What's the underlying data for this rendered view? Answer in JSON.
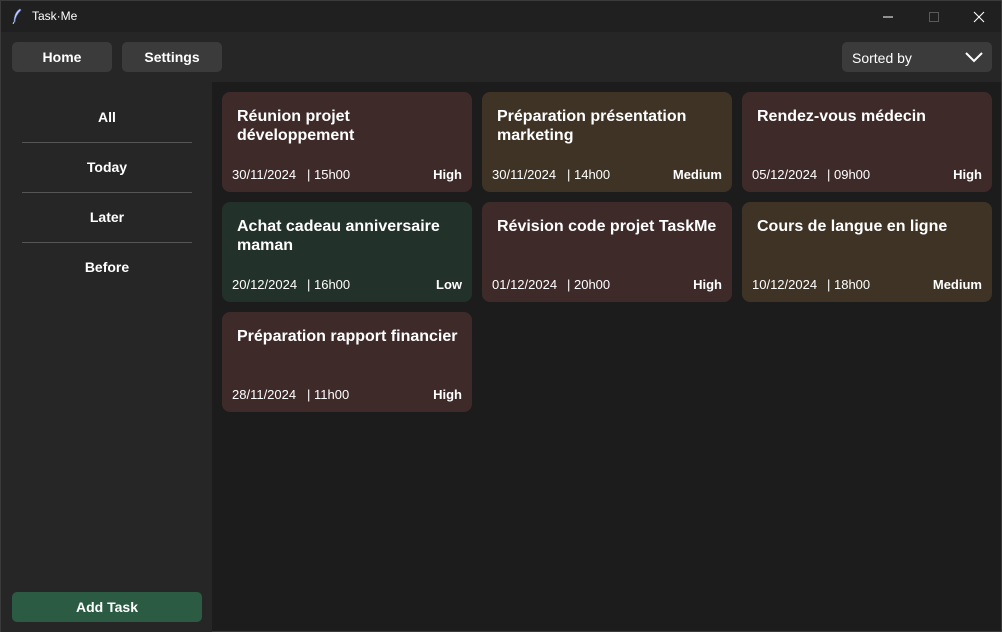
{
  "window": {
    "title": "Task·Me"
  },
  "topbar": {
    "home_label": "Home",
    "settings_label": "Settings",
    "sort_label": "Sorted by"
  },
  "sidebar": {
    "filters": [
      "All",
      "Today",
      "Later",
      "Before"
    ],
    "add_task_label": "Add Task"
  },
  "colors": {
    "high": "#3f2a2a",
    "medium": "#3e3325",
    "low": "#223129",
    "add_task": "#2b5c43"
  },
  "tasks": [
    {
      "title": "Réunion projet développement",
      "date": "30/11/2024",
      "time": "| 15h00",
      "priority": "High"
    },
    {
      "title": "Préparation présentation marketing",
      "date": "30/11/2024",
      "time": "| 14h00",
      "priority": "Medium"
    },
    {
      "title": "Rendez-vous médecin",
      "date": "05/12/2024",
      "time": "| 09h00",
      "priority": "High"
    },
    {
      "title": "Achat cadeau anniversaire maman",
      "date": "20/12/2024",
      "time": "| 16h00",
      "priority": "Low"
    },
    {
      "title": "Révision code projet TaskMe",
      "date": "01/12/2024",
      "time": "| 20h00",
      "priority": "High"
    },
    {
      "title": "Cours de langue en ligne",
      "date": "10/12/2024",
      "time": "| 18h00",
      "priority": "Medium"
    },
    {
      "title": "Préparation rapport financier",
      "date": "28/11/2024",
      "time": "| 11h00",
      "priority": "High"
    }
  ]
}
